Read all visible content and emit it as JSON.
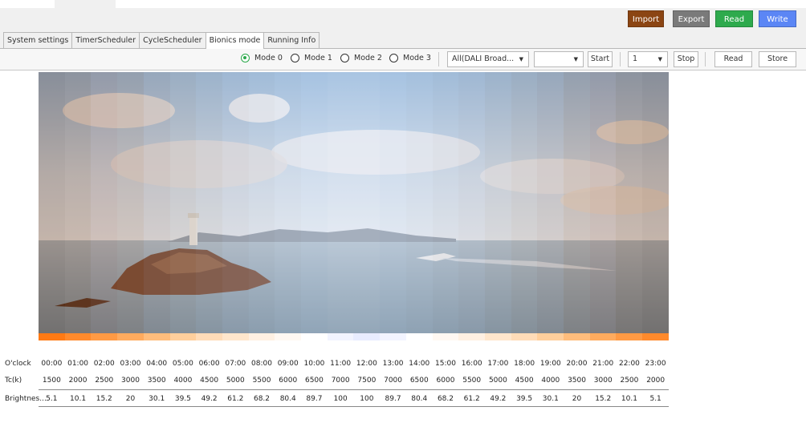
{
  "actions": {
    "import": {
      "label": "Import",
      "color": "#8b4513"
    },
    "export": {
      "label": "Export",
      "color": "#7a7a7a"
    },
    "read": {
      "label": "Read",
      "color": "#2eaa4d"
    },
    "write": {
      "label": "Write",
      "color": "#5b86f5"
    }
  },
  "tabs": [
    "System settings",
    "TimerScheduler",
    "CycleScheduler",
    "Bionics mode",
    "Running Info"
  ],
  "active_tab": "Bionics mode",
  "modes": [
    "Mode 0",
    "Mode 1",
    "Mode 2",
    "Mode 3"
  ],
  "selected_mode": "Mode 0",
  "toolbar": {
    "address_select": "All(DALI Broad...",
    "second_select": "",
    "start_label": "Start",
    "count_select": "1",
    "stop_label": "Stop",
    "read_label": "Read",
    "store_label": "Store"
  },
  "table": {
    "row_labels": {
      "hours": "O'clock",
      "tc": "Tc(k)",
      "brightness": "Brightnes..."
    },
    "hours": [
      "00:00",
      "01:00",
      "02:00",
      "03:00",
      "04:00",
      "05:00",
      "06:00",
      "07:00",
      "08:00",
      "09:00",
      "10:00",
      "11:00",
      "12:00",
      "13:00",
      "14:00",
      "15:00",
      "16:00",
      "17:00",
      "18:00",
      "19:00",
      "20:00",
      "21:00",
      "22:00",
      "23:00"
    ],
    "tc": [
      "1500",
      "2000",
      "2500",
      "3000",
      "3500",
      "4000",
      "4500",
      "5000",
      "5500",
      "6000",
      "6500",
      "7000",
      "7500",
      "7000",
      "6500",
      "6000",
      "5500",
      "5000",
      "4500",
      "4000",
      "3500",
      "3000",
      "2500",
      "2000"
    ],
    "brightness": [
      "5.1",
      "10.1",
      "15.2",
      "20",
      "30.1",
      "39.5",
      "49.2",
      "61.2",
      "68.2",
      "80.4",
      "89.7",
      "100",
      "100",
      "89.7",
      "80.4",
      "68.2",
      "61.2",
      "49.2",
      "39.5",
      "30.1",
      "20",
      "15.2",
      "10.1",
      "5.1"
    ]
  },
  "colors": {
    "strip_tints": [
      "#7a3a10",
      "#8a4a20",
      "#9a6040",
      "#a07050",
      "#a88a78",
      "#b09a90",
      "#b8aaa8",
      "#c0bcc0",
      "#c8c8d0",
      "#d0d4e0",
      "#d8dceb",
      "#e0e4f0",
      "#e0e4f0",
      "#d8dceb",
      "#d0d4e0",
      "#c8c8d0",
      "#c0bcc0",
      "#b8aaa8",
      "#b09a90",
      "#a88a78",
      "#a07050",
      "#9a6040",
      "#8a4a20",
      "#7a3a10"
    ],
    "bar_colors": [
      "#ff7a14",
      "#ff8a2c",
      "#ff9a44",
      "#ffab5e",
      "#ffbd7c",
      "#ffcf9c",
      "#ffdcb8",
      "#ffe6cc",
      "#fff0e2",
      "#fff8f2",
      "#ffffff",
      "#f2f4ff",
      "#e8ecff",
      "#f2f4ff",
      "#ffffff",
      "#fff8f2",
      "#fff0e2",
      "#ffe6cc",
      "#ffdcb8",
      "#ffcf9c",
      "#ffbd7c",
      "#ffab5e",
      "#ff9a44",
      "#ff8a2c"
    ]
  }
}
